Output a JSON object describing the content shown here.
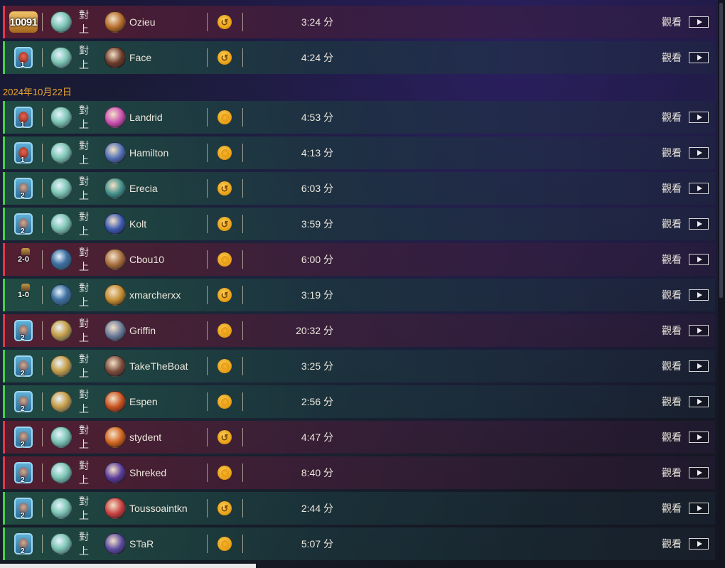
{
  "labels": {
    "vs": "對上",
    "watch": "觀看",
    "date": "2024年10月22日"
  },
  "top_rows": [
    {
      "result": "loss",
      "rank": "10091",
      "rank_style": "legend",
      "hero": "#7fc6b5",
      "opp_name": "Ozieu",
      "opp": "#b46a2a",
      "coin": "swirl",
      "time": "3:24 分"
    },
    {
      "result": "win",
      "rank": "1",
      "rank_style": "red",
      "hero": "#7fc6b5",
      "opp_name": "Face",
      "opp": "#6c3b2a",
      "coin": "swirl",
      "time": "4:24 分"
    }
  ],
  "rows": [
    {
      "result": "win",
      "rank": "1",
      "rank_style": "red",
      "hero": "#7fc6b5",
      "opp_name": "Landrid",
      "opp": "#c94fb0",
      "coin": "plain",
      "time": "4:53 分"
    },
    {
      "result": "win",
      "rank": "1",
      "rank_style": "red",
      "hero": "#7fc6b5",
      "opp_name": "Hamilton",
      "opp": "#4f6fb4",
      "coin": "plain",
      "time": "4:13 分"
    },
    {
      "result": "win",
      "rank": "2",
      "rank_style": "blue",
      "hero": "#7fc6b5",
      "opp_name": "Erecia",
      "opp": "#3f8e8a",
      "coin": "swirl",
      "time": "6:03 分"
    },
    {
      "result": "win",
      "rank": "2",
      "rank_style": "blue",
      "hero": "#7fc6b5",
      "opp_name": "Kolt",
      "opp": "#3a58b0",
      "coin": "swirl",
      "time": "3:59 分"
    },
    {
      "result": "loss",
      "rank": "2-0",
      "rank_style": "score",
      "hero": "#3d6fa0",
      "opp_name": "Cbou10",
      "opp": "#a46a3a",
      "coin": "plain",
      "time": "6:00 分"
    },
    {
      "result": "win",
      "rank": "1-0",
      "rank_style": "score",
      "hero": "#3d6fa0",
      "opp_name": "xmarcherxx",
      "opp": "#c08a2e",
      "coin": "swirl",
      "time": "3:19 分"
    },
    {
      "result": "loss",
      "rank": "2",
      "rank_style": "blue",
      "hero": "#c9a04a",
      "opp_name": "Griffin",
      "opp": "#6a7a9a",
      "coin": "plain",
      "time": "20:32 分"
    },
    {
      "result": "win",
      "rank": "2",
      "rank_style": "blue",
      "hero": "#c9a04a",
      "opp_name": "TakeTheBoat",
      "opp": "#7a4a3a",
      "coin": "plain",
      "time": "3:25 分"
    },
    {
      "result": "win",
      "rank": "2",
      "rank_style": "blue",
      "hero": "#c9a04a",
      "opp_name": "Espen",
      "opp": "#c8501e",
      "coin": "plain",
      "time": "2:56 分"
    },
    {
      "result": "loss",
      "rank": "2",
      "rank_style": "blue",
      "hero": "#7fc6b5",
      "opp_name": "stydent",
      "opp": "#d0641e",
      "coin": "swirl",
      "time": "4:47 分"
    },
    {
      "result": "loss",
      "rank": "2",
      "rank_style": "blue",
      "hero": "#7fc6b5",
      "opp_name": "Shreked",
      "opp": "#5a3a9a",
      "coin": "plain",
      "time": "8:40 分"
    },
    {
      "result": "win",
      "rank": "2",
      "rank_style": "blue",
      "hero": "#7fc6b5",
      "opp_name": "Toussoaintkn",
      "opp": "#c84040",
      "coin": "swirl",
      "time": "2:44 分"
    },
    {
      "result": "win",
      "rank": "2",
      "rank_style": "blue",
      "hero": "#7fc6b5",
      "opp_name": "STaR",
      "opp": "#5a4aa0",
      "coin": "plain",
      "time": "5:07 分"
    }
  ]
}
